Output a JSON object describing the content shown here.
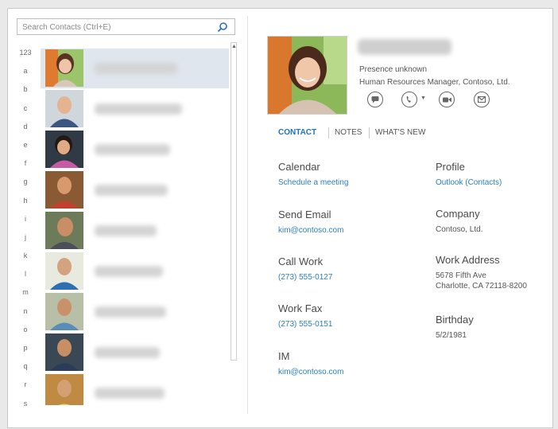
{
  "search": {
    "placeholder": "Search Contacts (Ctrl+E)",
    "icon": "search-icon"
  },
  "alphabet": [
    "123",
    "a",
    "b",
    "c",
    "d",
    "e",
    "f",
    "g",
    "h",
    "i",
    "j",
    "k",
    "l",
    "m",
    "n",
    "o",
    "p",
    "q",
    "r",
    "s"
  ],
  "contact": {
    "presence": "Presence unknown",
    "title": "Human Resources Manager, Contoso, Ltd."
  },
  "tabs": {
    "contact": "CONTACT",
    "notes": "NOTES",
    "whats_new": "WHAT'S NEW"
  },
  "fields": {
    "calendar": {
      "label": "Calendar",
      "value": "Schedule a meeting"
    },
    "profile": {
      "label": "Profile",
      "value": "Outlook (Contacts)"
    },
    "send_email": {
      "label": "Send Email",
      "value": "kim@contoso.com"
    },
    "company": {
      "label": "Company",
      "value": "Contoso, Ltd."
    },
    "call_work": {
      "label": "Call Work",
      "value": "(273) 555-0127"
    },
    "work_address": {
      "label": "Work Address",
      "line1": "5678 Fifth Ave",
      "line2": "Charlotte, CA 72118-8200"
    },
    "work_fax": {
      "label": "Work Fax",
      "value": "(273) 555-0151"
    },
    "birthday": {
      "label": "Birthday",
      "value": "5/2/1981"
    },
    "im": {
      "label": "IM",
      "value": "kim@contoso.com"
    }
  }
}
